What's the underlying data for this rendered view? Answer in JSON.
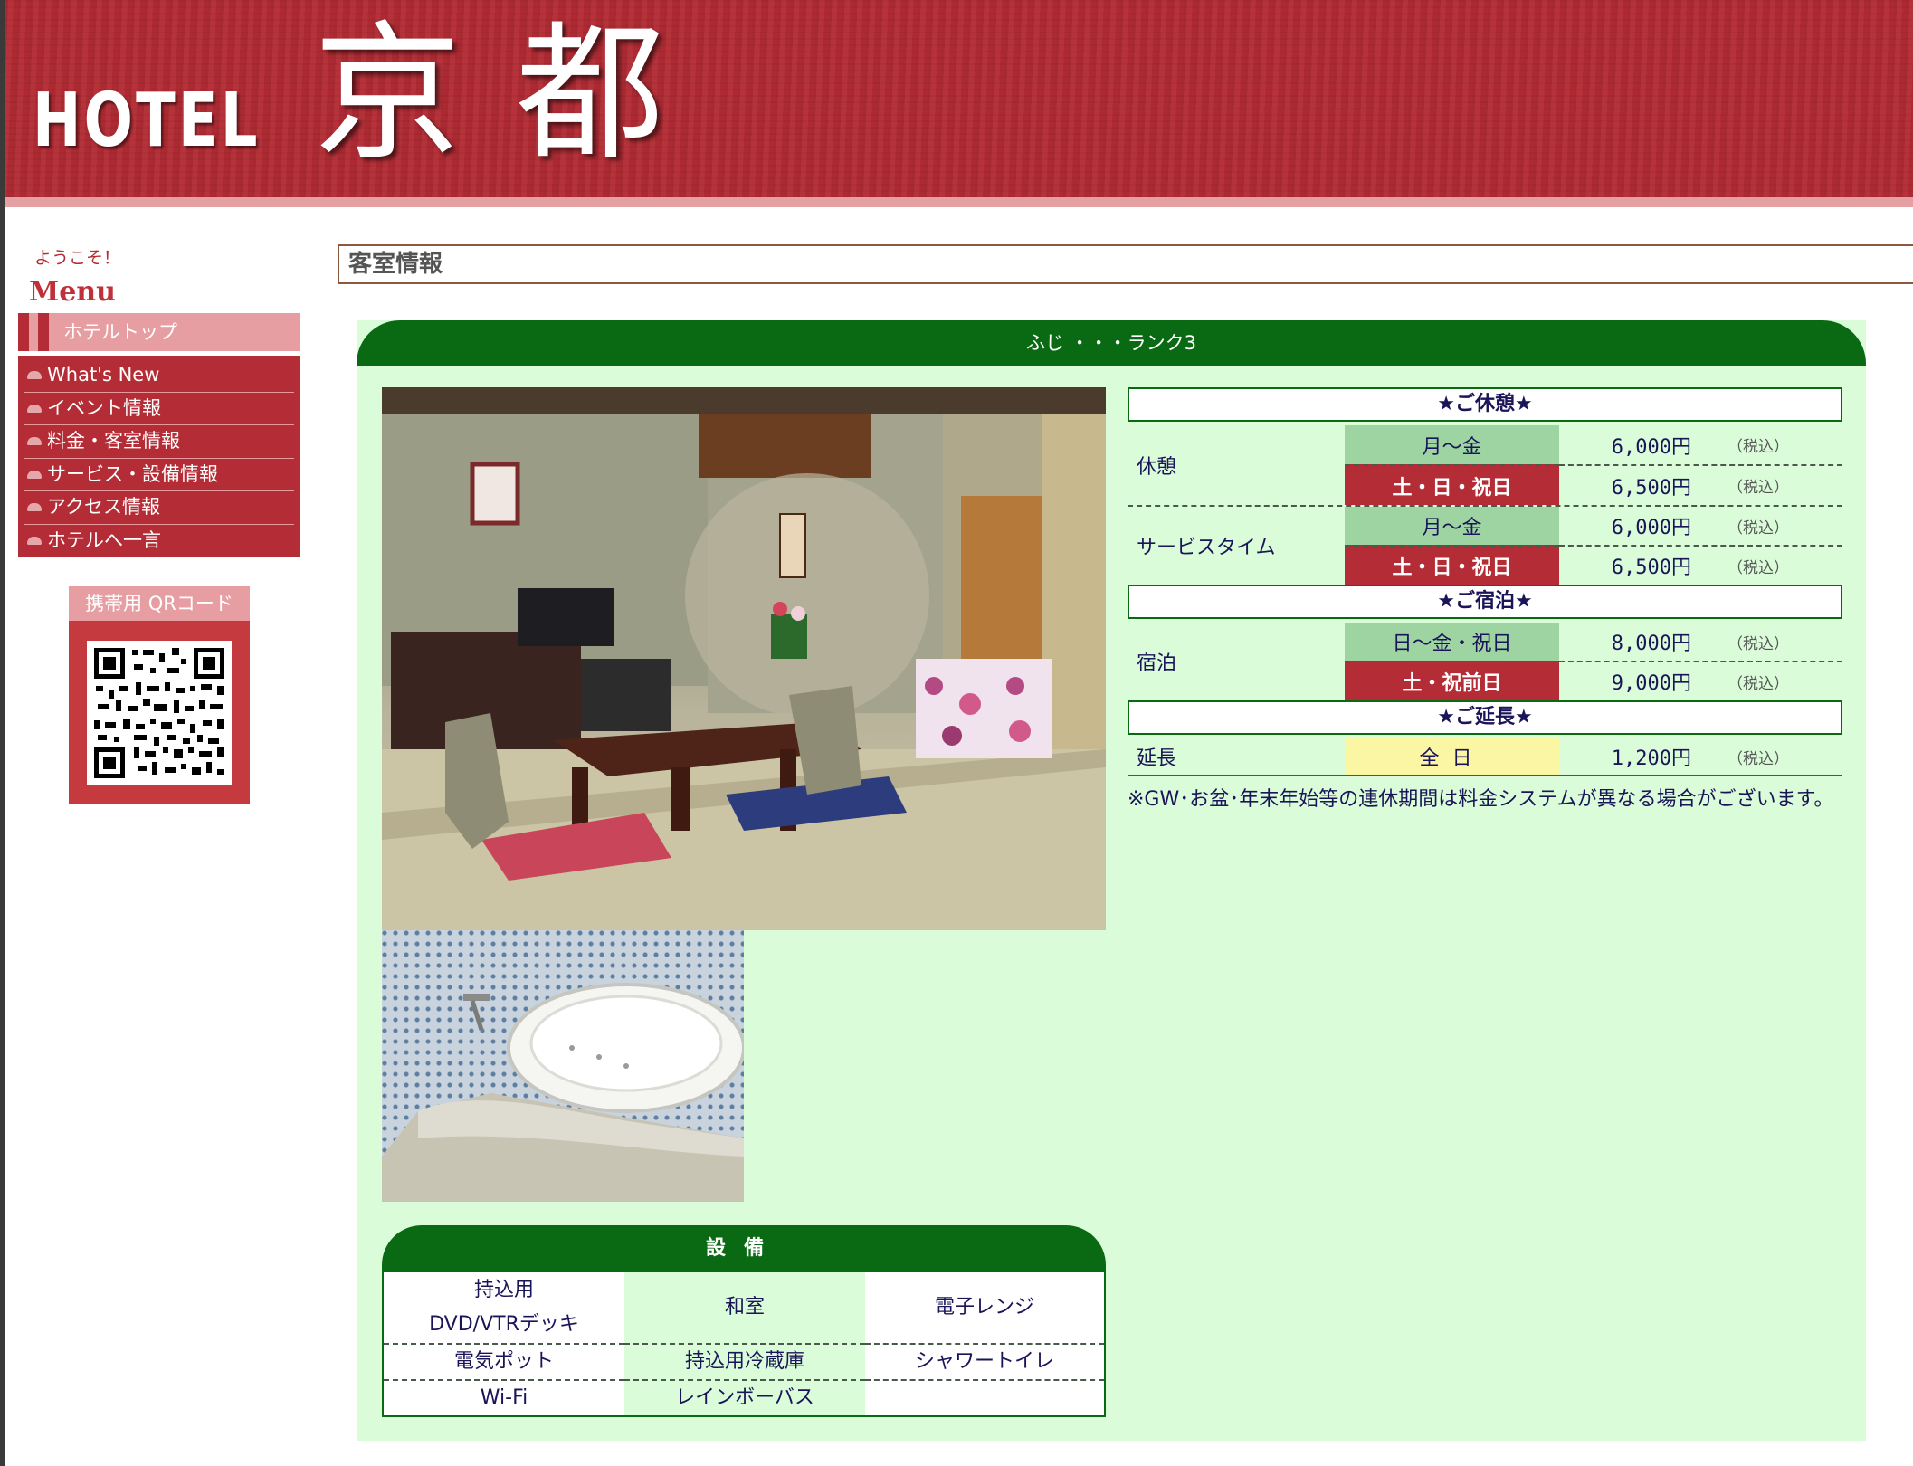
{
  "header": {
    "logo_hotel": "HOTEL",
    "logo_name": "京都"
  },
  "sidebar": {
    "welcome": "ようこそ！",
    "menu_title": "Menu",
    "hotel_top": "ホテルトップ",
    "items": [
      {
        "label": "What's New"
      },
      {
        "label": "イベント情報"
      },
      {
        "label": "料金・客室情報"
      },
      {
        "label": "サービス・設備情報"
      },
      {
        "label": "アクセス情報"
      },
      {
        "label": "ホテルへ一言"
      }
    ],
    "qr_title": "携帯用 QRコード"
  },
  "page": {
    "title": "客室情報"
  },
  "room": {
    "name": "ふじ ・・・ランク3"
  },
  "pricing": {
    "rest_header": "★ご休憩★",
    "stay_header": "★ご宿泊★",
    "ext_header": "★ご延長★",
    "tax_label": "（税込）",
    "rows": {
      "rest": {
        "label": "休憩",
        "weekday": "月～金",
        "weekday_price": "6,000円",
        "weekend": "土・日・祝日",
        "weekend_price": "6,500円"
      },
      "service": {
        "label": "サービスタイム",
        "weekday": "月～金",
        "weekday_price": "6,000円",
        "weekend": "土・日・祝日",
        "weekend_price": "6,500円"
      },
      "stay": {
        "label": "宿泊",
        "weekday": "日～金・祝日",
        "weekday_price": "8,000円",
        "weekend": "土・祝前日",
        "weekend_price": "9,000円"
      },
      "ext": {
        "label": "延長",
        "day": "全日",
        "price": "1,200円"
      }
    },
    "note": "※GW･お盆･年末年始等の連休期間は料金システムが異なる場合がございます。"
  },
  "equipment": {
    "title": "設備",
    "cells": [
      "持込用\nDVD/VTRデッキ",
      "和室",
      "電子レンジ",
      "電気ポット",
      "持込用冷蔵庫",
      "シャワートイレ",
      "Wi-Fi",
      "レインボーバス",
      ""
    ]
  },
  "colors": {
    "brand_red": "#b42c35",
    "green": "#0a6a14",
    "panel_bg": "#dafcd9"
  }
}
